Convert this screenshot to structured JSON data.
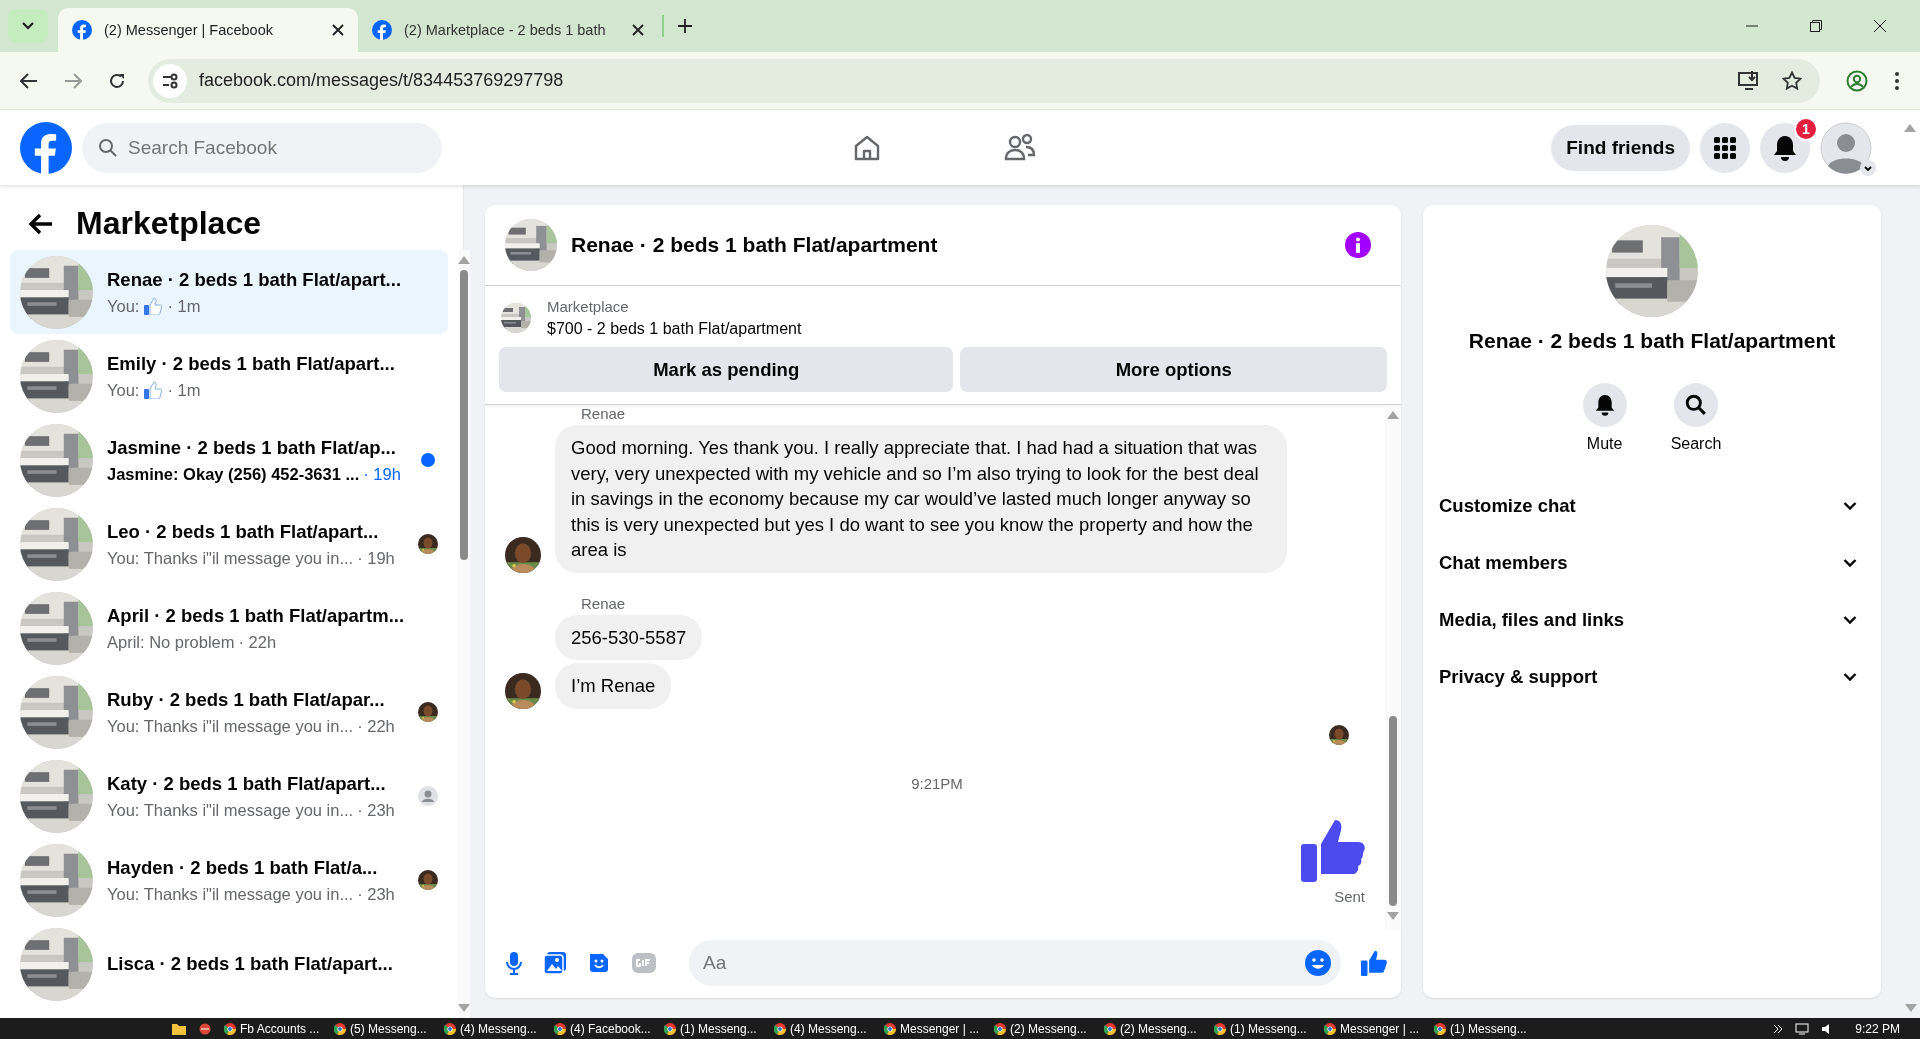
{
  "browser": {
    "tabs": [
      {
        "title": "(2) Messenger | Facebook",
        "selected": true
      },
      {
        "title": "(2) Marketplace - 2 beds 1 bath",
        "selected": false
      }
    ],
    "url": "facebook.com/messages/t/834453769297798"
  },
  "header": {
    "search_placeholder": "Search Facebook",
    "find_friends": "Find friends",
    "notification_count": "1"
  },
  "sidebar": {
    "title": "Marketplace",
    "conversations": [
      {
        "title": "Renae · 2 beds 1 bath Flat/apart...",
        "preview": "You:",
        "like": true,
        "time": "· 1m",
        "unread": false,
        "selected": true,
        "kind": "none"
      },
      {
        "title": "Emily · 2 beds 1 bath Flat/apart...",
        "preview": "You:",
        "like": true,
        "time": "· 1m",
        "unread": false,
        "selected": false,
        "kind": "none"
      },
      {
        "title": "Jasmine · 2 beds 1 bath Flat/ap...",
        "preview": "Jasmine: Okay (256) 452-3631 ...",
        "like": false,
        "time": "· 19h",
        "unread": true,
        "selected": false,
        "kind": "dot"
      },
      {
        "title": "Leo · 2 beds 1 bath Flat/apart...",
        "preview": "You: Thanks i\"il message you in...",
        "like": false,
        "time": "· 19h",
        "unread": false,
        "selected": false,
        "kind": "seen"
      },
      {
        "title": "April · 2 beds 1 bath Flat/apartm...",
        "preview": "April: No problem",
        "like": false,
        "time": "· 22h",
        "unread": false,
        "selected": false,
        "kind": "none"
      },
      {
        "title": "Ruby · 2 beds 1 bath Flat/apar...",
        "preview": "You: Thanks i\"il message you in...",
        "like": false,
        "time": "· 22h",
        "unread": false,
        "selected": false,
        "kind": "seen"
      },
      {
        "title": "Katy · 2 beds 1 bath Flat/apart...",
        "preview": "You: Thanks i\"il message you in...",
        "like": false,
        "time": "· 23h",
        "unread": false,
        "selected": false,
        "kind": "silhouette"
      },
      {
        "title": "Hayden · 2 beds 1 bath Flat/a...",
        "preview": "You: Thanks i\"il message you in...",
        "like": false,
        "time": "· 23h",
        "unread": false,
        "selected": false,
        "kind": "seen"
      },
      {
        "title": "Lisca · 2 beds 1 bath Flat/apart...",
        "selected": false,
        "kind": "none"
      }
    ]
  },
  "chat": {
    "title": "Renae · 2 beds 1 bath Flat/apartment",
    "listing_label": "Marketplace",
    "listing_text": "$700 - 2 beds 1 bath Flat/apartment",
    "buttons": [
      "Mark as pending",
      "More options"
    ],
    "groups": [
      {
        "sender": "Renae",
        "bubbles": [
          "Good morning. Yes thank you. I really appreciate that. I had had a situation that was very, very unexpected with my vehicle and so I’m also trying to look for the best deal in savings in the economy because my car would’ve lasted much longer anyway so this is very unexpected but yes I do want to see you know the property and how the area is"
        ]
      },
      {
        "sender": "Renae",
        "bubbles": [
          "256-530-5587",
          "I’m Renae"
        ]
      }
    ],
    "time": "9:21PM",
    "status": "Sent",
    "composer_placeholder": "Aa"
  },
  "details": {
    "name": "Renae · 2 beds 1 bath Flat/apartment",
    "actions": [
      {
        "kind": "bell",
        "label": "Mute"
      },
      {
        "kind": "search",
        "label": "Search"
      }
    ],
    "sections": [
      "Customize chat",
      "Chat members",
      "Media, files and links",
      "Privacy & support"
    ]
  },
  "taskbar": {
    "items": [
      "Fb Accounts ...",
      "(5) Messeng...",
      "(4) Messeng...",
      "(4) Facebook...",
      "(1) Messeng...",
      "(4) Messeng...",
      "Messenger | ...",
      "(2) Messeng...",
      "(2) Messeng...",
      "(1) Messeng...",
      "Messenger | ...",
      "(1) Messeng..."
    ],
    "time": "9:22 PM"
  }
}
